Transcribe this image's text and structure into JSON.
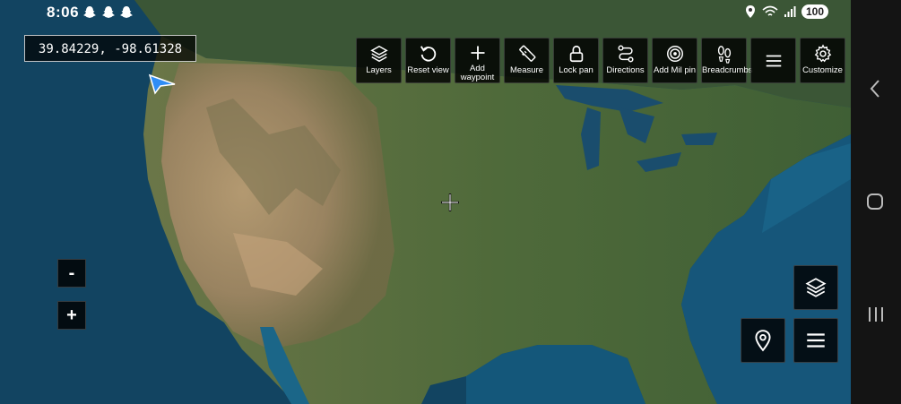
{
  "status_bar": {
    "time": "8:06",
    "battery": "100",
    "notification_icons": [
      "snapchat-icon",
      "snapchat-icon",
      "snapchat-icon"
    ]
  },
  "coordinates": "39.84229, -98.61328",
  "toolbar": [
    {
      "label": "Layers",
      "icon": "layers-icon"
    },
    {
      "label": "Reset view",
      "icon": "reset-icon"
    },
    {
      "label": "Add waypoint",
      "icon": "plus-icon"
    },
    {
      "label": "Measure",
      "icon": "ruler-icon"
    },
    {
      "label": "Lock pan",
      "icon": "lock-icon"
    },
    {
      "label": "Directions",
      "icon": "directions-icon"
    },
    {
      "label": "Add Mil pin",
      "icon": "target-icon"
    },
    {
      "label": "Breadcrumbs",
      "icon": "footprints-icon"
    },
    {
      "label": "",
      "icon": "menu-icon"
    },
    {
      "label": "Customize",
      "icon": "gear-icon"
    }
  ],
  "zoom": {
    "out_label": "-",
    "in_label": "+"
  },
  "colors": {
    "ocean": "#124461",
    "land": "#5a6b3e",
    "desert": "#a58a63",
    "panel": "#000000"
  }
}
